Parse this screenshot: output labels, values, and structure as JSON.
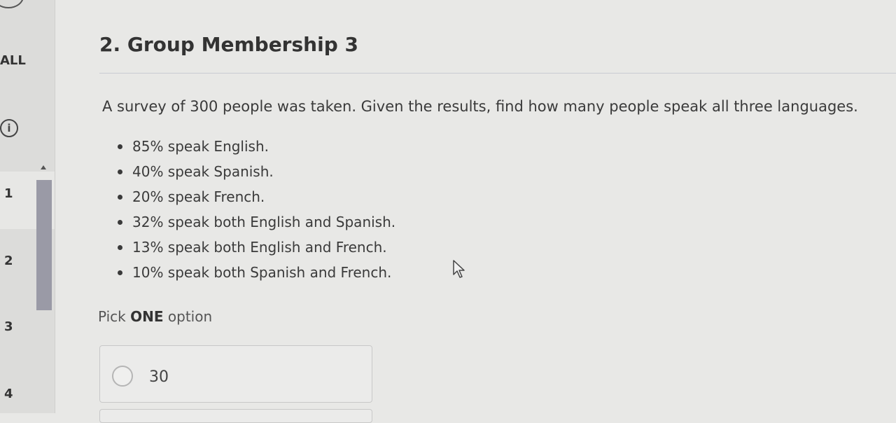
{
  "sidebar": {
    "all_label": "ALL",
    "info_icon_glyph": "i",
    "questions": [
      "1",
      "2",
      "3",
      "4"
    ],
    "selected_question": "1"
  },
  "question": {
    "title": "2. Group Membership 3",
    "prompt": "A survey of 300 people was taken. Given the results, find how many people speak all three languages.",
    "facts": [
      "85% speak English.",
      "40% speak Spanish.",
      "20% speak French.",
      "32% speak both English and Spanish.",
      "13% speak both English and French.",
      "10% speak both Spanish and French."
    ],
    "pick_prefix": "Pick ",
    "pick_strong": "ONE",
    "pick_suffix": " option",
    "options": [
      "30"
    ]
  },
  "icons": {
    "info": "info-icon",
    "cursor": "mouse-pointer-icon",
    "scroll_up": "caret-up-icon"
  }
}
